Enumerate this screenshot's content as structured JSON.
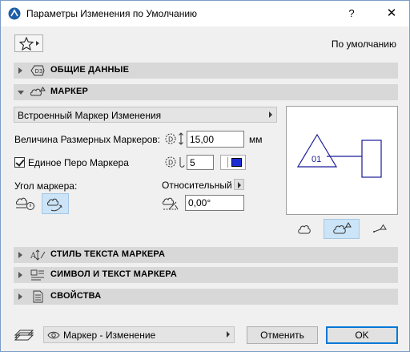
{
  "window": {
    "title": "Параметры Изменения по Умолчанию",
    "help": "?",
    "close": "✕"
  },
  "header": {
    "default_label": "По умолчанию"
  },
  "sections": {
    "general": "ОБЩИЕ ДАННЫЕ",
    "marker": "МАРКЕР",
    "text_style": "СТИЛЬ ТЕКСТА МАРКЕРА",
    "symbol_text": "СИМВОЛ И ТЕКСТ МАРКЕРА",
    "properties": "СВОЙСТВА"
  },
  "marker": {
    "type_dropdown": "Встроенный Маркер Изменения",
    "size_label": "Величина Размерных Маркеров:",
    "size_value": "15,00",
    "size_unit": "мм",
    "pen_checkbox_label": "Единое Перо Маркера",
    "pen_checked": true,
    "pen_value": "5",
    "pen_color": "#1a2bd4",
    "angle_label": "Угол маркера:",
    "relative_label": "Относительный",
    "angle_value": "0,00°",
    "preview_number": "01"
  },
  "footer": {
    "layer_dropdown": "Маркер - Изменение",
    "cancel": "Отменить",
    "ok": "OK"
  }
}
